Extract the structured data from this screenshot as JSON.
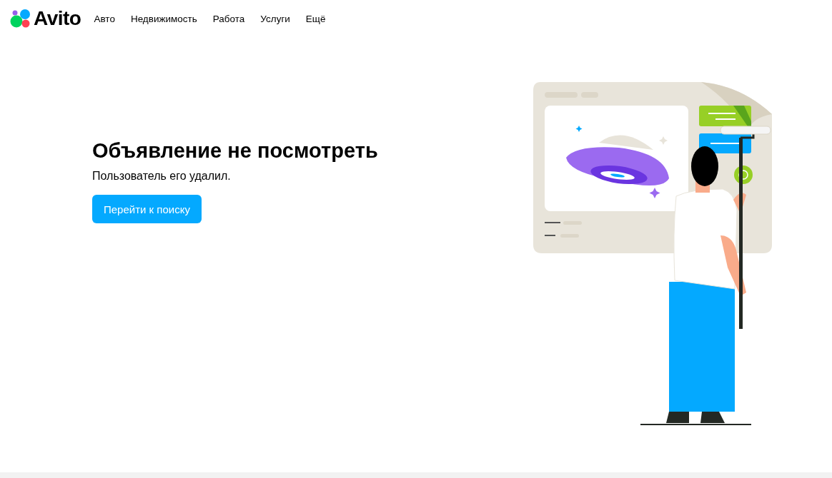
{
  "header": {
    "logo": "Avito",
    "nav": [
      "Авто",
      "Недвижимость",
      "Работа",
      "Услуги",
      "Ещё"
    ]
  },
  "message": {
    "title": "Объявление не посмотреть",
    "text": "Пользователь его удалил.",
    "button": "Перейти к поиску"
  }
}
